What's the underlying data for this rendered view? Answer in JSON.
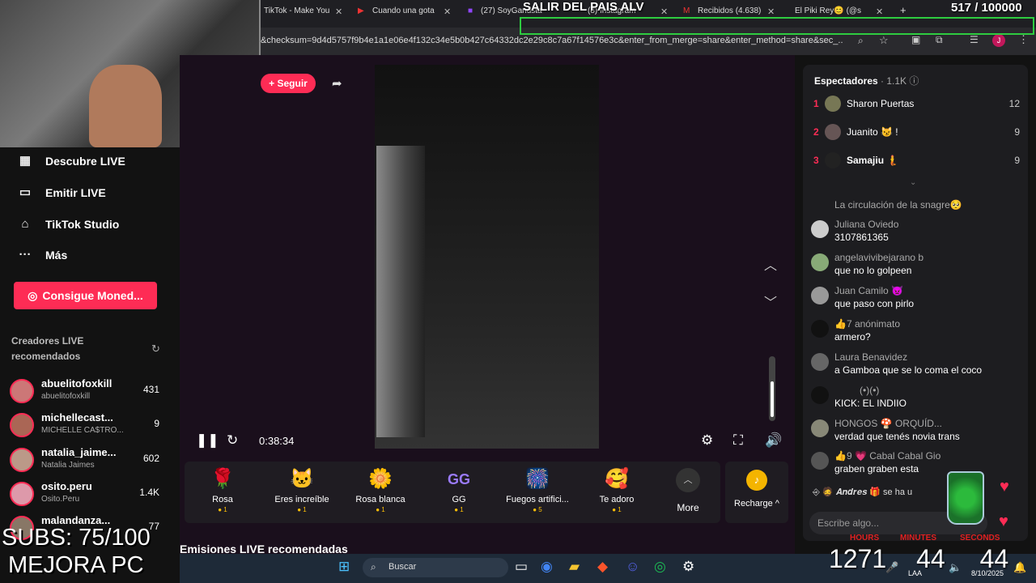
{
  "browser": {
    "tabs": [
      {
        "label": "TikTok - Make You"
      },
      {
        "label": "Cuando una gota"
      },
      {
        "label": "(27) SoyGandsta"
      },
      {
        "label": "(8) Instagram"
      },
      {
        "label": "Recibidos (4.638)"
      },
      {
        "label": "El Piki Rey😊 (@s"
      }
    ],
    "new_tab": "+",
    "url": "&checksum=9d4d5757f9b4e1a1e06e4f132c34e5b0b427c64332dc2e29c8c7a67f14576e3c&enter_from_merge=share&enter_method=share&sec_..."
  },
  "overlay": {
    "title": "SALIR DEL PAIS ALV",
    "counter": "517   / 100000",
    "subs": "SUBS: 75/100",
    "mejora": "MEJORA PC",
    "timer_hours": "1271",
    "timer_minutes": "44",
    "timer_seconds": "44",
    "hours_label": "HOURS",
    "minutes_label": "MINUTES",
    "seconds_label": "SECONDS"
  },
  "sidebar": {
    "items": [
      {
        "label": "Descubre LIVE",
        "icon": "calendar-icon"
      },
      {
        "label": "Emitir LIVE",
        "icon": "video-icon"
      },
      {
        "label": "TikTok Studio",
        "icon": "studio-icon"
      },
      {
        "label": "Más",
        "icon": "more-icon"
      }
    ],
    "coins_button": "Consigue Moned...",
    "creators_title": "Creadores LIVE recomendados",
    "creators": [
      {
        "name": "abuelitofoxkill",
        "handle": "abuelitofoxkill",
        "count": "431"
      },
      {
        "name": "michellecast...",
        "handle": "MICHELLE CA$TRO...",
        "count": "9"
      },
      {
        "name": "natalia_jaime...",
        "handle": "Natalia Jaimes",
        "count": "602"
      },
      {
        "name": "osito.peru",
        "handle": "Osito.Peru",
        "count": "1.4K"
      },
      {
        "name": "malandanza...",
        "handle": "",
        "count": "77"
      }
    ]
  },
  "player": {
    "follow": "+ Seguir",
    "time": "0:38:34",
    "volume_level": 0.55,
    "gifts": [
      {
        "name": "Rosa",
        "price": "1",
        "icon": "🌹"
      },
      {
        "name": "Eres increíble",
        "price": "1",
        "icon": "🐱"
      },
      {
        "name": "Rosa blanca",
        "price": "1",
        "icon": "🌼"
      },
      {
        "name": "GG",
        "price": "1",
        "icon": "GG"
      },
      {
        "name": "Fuegos artifici...",
        "price": "5",
        "icon": "🎆"
      },
      {
        "name": "Te adoro",
        "price": "1",
        "icon": "🥰"
      }
    ],
    "more": "More",
    "recharge": "Recharge",
    "recommended": "Emisiones LIVE recomendadas"
  },
  "chat": {
    "viewers_label": "Espectadores",
    "viewers_count": "· 1.1K",
    "top": [
      {
        "rank": "1",
        "name": "Sharon Puertas",
        "score": "12"
      },
      {
        "rank": "2",
        "name": "Juanito 😼 !",
        "score": "9"
      },
      {
        "rank": "3",
        "name": "Samajiu 🧜",
        "score": "9"
      }
    ],
    "system": "La circulación de la snagre🥺",
    "messages": [
      {
        "user": "Juliana Oviedo",
        "text": "3107861365"
      },
      {
        "user": "angelavivibejarano b",
        "text": "que no lo golpeen"
      },
      {
        "user": "Juan Camilo 👿",
        "text": "que paso con pirlo"
      },
      {
        "user": "👍7 anónimato",
        "text": "armero?"
      },
      {
        "user": "Laura Benavidez",
        "text": "a Gamboa que se lo coma el coco"
      },
      {
        "user": "(•)(•)",
        "text": "KICK: EL INDIIO"
      },
      {
        "user": "HONGOS 🍄 ORQUÍD...",
        "text": "verdad que tenés novia trans"
      },
      {
        "user": "👍9 💗 Cabal Cabal Gio",
        "text": "graben graben esta"
      }
    ],
    "join_text": "🧔 𝑨𝒏𝒅𝒓𝒆𝒔 🎁   se ha u",
    "input_placeholder": "Escribe algo..."
  },
  "taskbar": {
    "search": "Buscar",
    "lang": "LAA",
    "date": "8/10/2025"
  },
  "colors": {
    "accent": "#fe2c55",
    "bg": "#121212"
  }
}
